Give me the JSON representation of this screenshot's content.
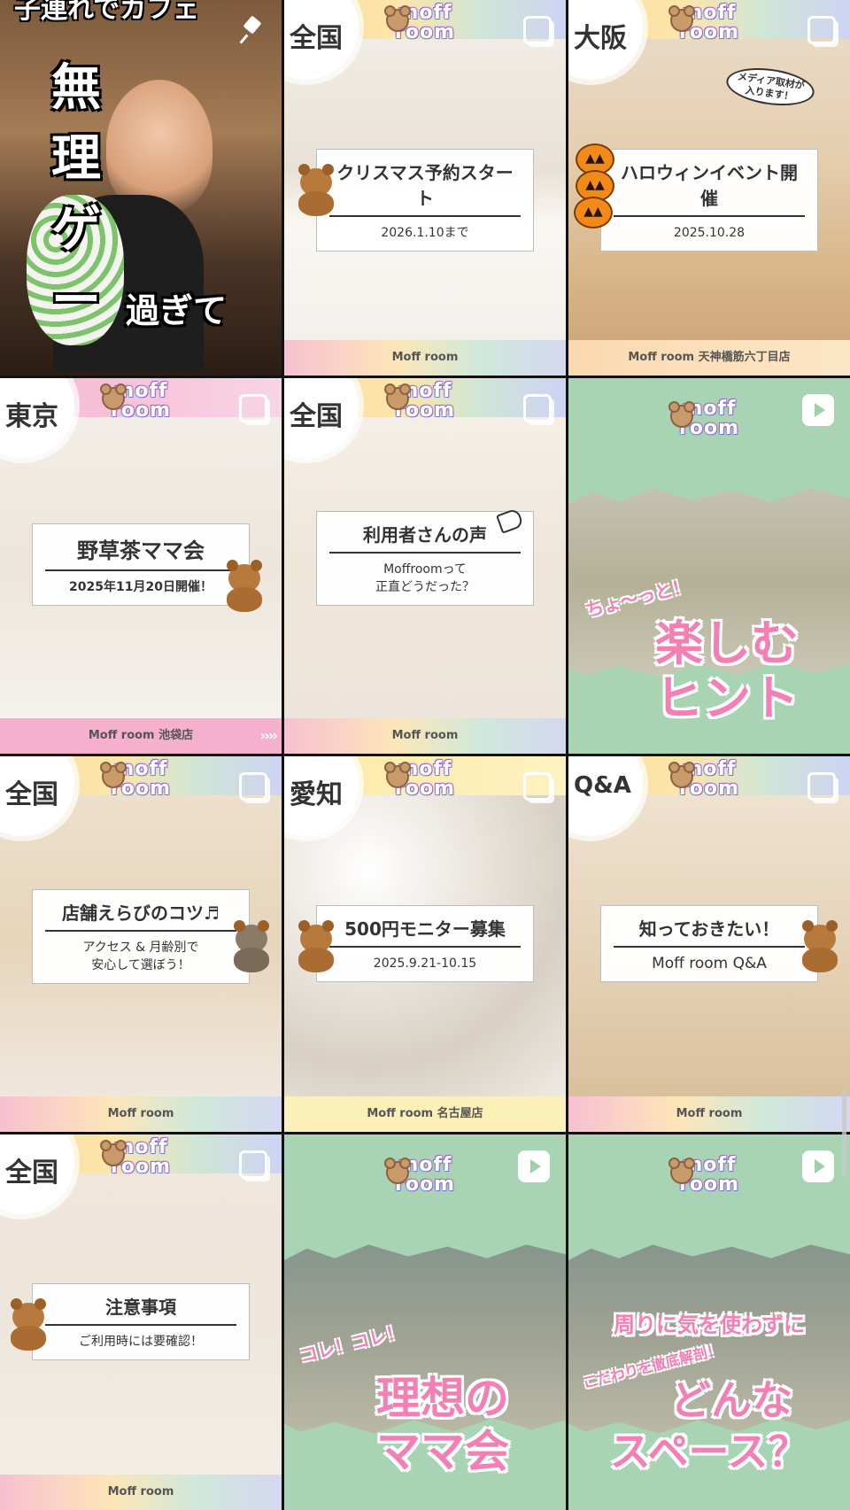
{
  "tiles": {
    "t1": {
      "top_text": "子連れでカフェ",
      "vertical_text": "無理ゲー",
      "side_text": "過ぎて"
    },
    "t2": {
      "region": "全国",
      "card_title": "クリスマス予約スタート",
      "card_sub": "2026.1.10まで",
      "footer": "Moff room"
    },
    "t3": {
      "region": "大阪",
      "bubble": "メディア取材が\n入ります！",
      "card_title": "ハロウィンイベント開催",
      "card_sub": "2025.10.28",
      "footer": "Moff room 天神橋筋六丁目店"
    },
    "t4": {
      "region": "東京",
      "card_title": "野草茶ママ会",
      "card_sub": "2025年11月20日開催！",
      "footer": "Moff room 池袋店",
      "footer_arrows": "››››"
    },
    "t5": {
      "region": "全国",
      "card_title": "利用者さんの声",
      "card_sub": "Moffroomって\n正直どうだった？",
      "footer": "Moff room"
    },
    "t6": {
      "small_text": "ちょ〜っと！",
      "big_text_1": "楽しむ",
      "big_text_2": "ヒント"
    },
    "t7": {
      "region": "全国",
      "card_title": "店舗えらびのコツ♬",
      "card_sub": "アクセス & 月齢別で\n安心して選ぼう！",
      "footer": "Moff room"
    },
    "t8": {
      "region": "愛知",
      "card_title": "500円モニター募集",
      "card_sub": "2025.9.21-10.15",
      "footer": "Moff room 名古屋店"
    },
    "t9": {
      "region": "Q&A",
      "card_title": "知っておきたい！",
      "card_sub": "Moff room Q&A",
      "footer": "Moff room"
    },
    "t10": {
      "region": "全国",
      "card_title": "注意事項",
      "card_sub": "ご利用時には要確認！",
      "footer": "Moff room"
    },
    "t11": {
      "small_text": "コレ！コレ！",
      "big_text_1": "理想の",
      "big_text_2": "ママ会"
    },
    "t12": {
      "top_text": "周りに気を使わずに",
      "small_text": "こだわりを徹底解剖！",
      "big_text_1": "どんな",
      "big_text_2": "スペース？"
    }
  },
  "logo": {
    "line1": "moff",
    "line2": "room"
  },
  "icons": {
    "pinned": "pin-icon",
    "multi_image": "carousel-icon",
    "reel": "play-icon"
  },
  "colors": {
    "pink": "#f47fb3",
    "mint": "#a9d4b3",
    "footer_pink": "#f4b0cd"
  }
}
